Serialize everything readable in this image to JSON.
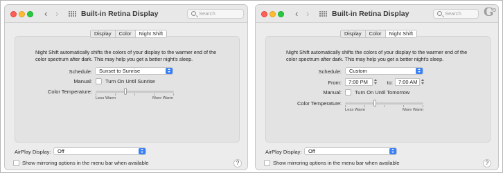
{
  "logo_text": "G",
  "left_window": {
    "title": "Built-in Retina Display",
    "search_placeholder": "Search",
    "tabs": [
      "Display",
      "Color",
      "Night Shift"
    ],
    "selected_tab": "Night Shift",
    "description": "Night Shift automatically shifts the colors of your display to the warmer end of the color spectrum after dark. This may help you get a better night's sleep.",
    "schedule_label": "Schedule:",
    "schedule_value": "Sunset to Sunrise",
    "manual_label": "Manual:",
    "manual_checkbox_label": "Turn On Until Sunrise",
    "manual_checked": false,
    "color_temp_label": "Color Temperature:",
    "less_warm": "Less Warm",
    "more_warm": "More Warm",
    "color_temp_level": 0.35,
    "airplay_label": "AirPlay Display:",
    "airplay_value": "Off",
    "mirroring_label": "Show mirroring options in the menu bar when available",
    "mirroring_checked": false,
    "help": "?"
  },
  "right_window": {
    "title": "Built-in Retina Display",
    "search_placeholder": "Search",
    "tabs": [
      "Display",
      "Color",
      "Night Shift"
    ],
    "selected_tab": "Night Shift",
    "description": "Night Shift automatically shifts the colors of your display to the warmer end of the color spectrum after dark. This may help you get a better night's sleep.",
    "schedule_label": "Schedule:",
    "schedule_value": "Custom",
    "from_label": "From:",
    "from_value": "7:00 PM",
    "to_label": "to:",
    "to_value": "7:00 AM",
    "manual_label": "Manual:",
    "manual_checkbox_label": "Turn On Until Tomorrow",
    "manual_checked": false,
    "color_temp_label": "Color Temperature:",
    "less_warm": "Less Warm",
    "more_warm": "More Warm",
    "color_temp_level": 0.35,
    "airplay_label": "AirPlay Display:",
    "airplay_value": "Off",
    "mirroring_label": "Show mirroring options in the menu bar when available",
    "mirroring_checked": false,
    "help": "?"
  },
  "colors": {
    "accent": "#3a80f5",
    "window_bg": "#ececec",
    "panel_bg": "#e3e3e3",
    "close": "#fe5f57",
    "minimize": "#febc2e",
    "zoom": "#28c840"
  },
  "icons": [
    "close-icon",
    "minimize-icon",
    "zoom-icon",
    "chevron-left-icon",
    "chevron-right-icon",
    "grid-icon",
    "search-icon",
    "chevron-updown-icon",
    "help-icon"
  ]
}
